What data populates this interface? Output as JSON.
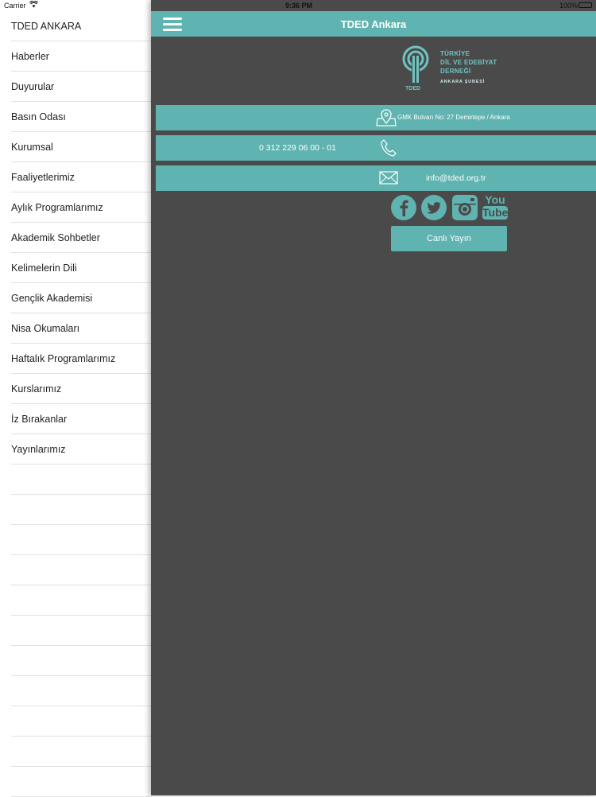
{
  "status_bar": {
    "carrier": "Carrier",
    "time": "9:36 PM",
    "battery": "100%"
  },
  "side_menu": {
    "title": "TDED ANKARA",
    "items": [
      {
        "label": "Haberler"
      },
      {
        "label": "Duyurular"
      },
      {
        "label": "Basın Odası"
      },
      {
        "label": "Kurumsal"
      },
      {
        "label": "Faaliyetlerimiz"
      },
      {
        "label": "Aylık Programlarımız"
      },
      {
        "label": "Akademik Sohbetler"
      },
      {
        "label": "Kelimelerin Dili"
      },
      {
        "label": "Gençlik Akademisi"
      },
      {
        "label": "Nisa Okumaları"
      },
      {
        "label": "Haftalık Programlarımız"
      },
      {
        "label": "Kurslarımız"
      },
      {
        "label": "İz Bırakanlar"
      },
      {
        "label": "Yayınlarımız"
      }
    ]
  },
  "navbar": {
    "title": "TDED Ankara",
    "menu_icon": "hamburger-icon"
  },
  "logo": {
    "line1": "TÜRKİYE",
    "line2": "DİL VE EDEBİYAT",
    "line3": "DERNEĞİ",
    "subtitle": "ANKARA ŞUBESİ",
    "abbr": "TDED"
  },
  "contact": {
    "address": "GMK Bulvarı No: 27 Demirtepe / Ankara",
    "phone": "0 312 229 06 00 - 01",
    "email": "info@tded.org.tr"
  },
  "social": {
    "icons": [
      "facebook-icon",
      "twitter-icon",
      "instagram-icon",
      "youtube-icon"
    ],
    "youtube_you": "You",
    "youtube_tube": "Tube"
  },
  "live_button": {
    "label": "Canlı Yayın"
  },
  "colors": {
    "accent": "#5fb3b0",
    "panel_bg": "#4a4a4b",
    "menu_bg": "#ffffff"
  }
}
